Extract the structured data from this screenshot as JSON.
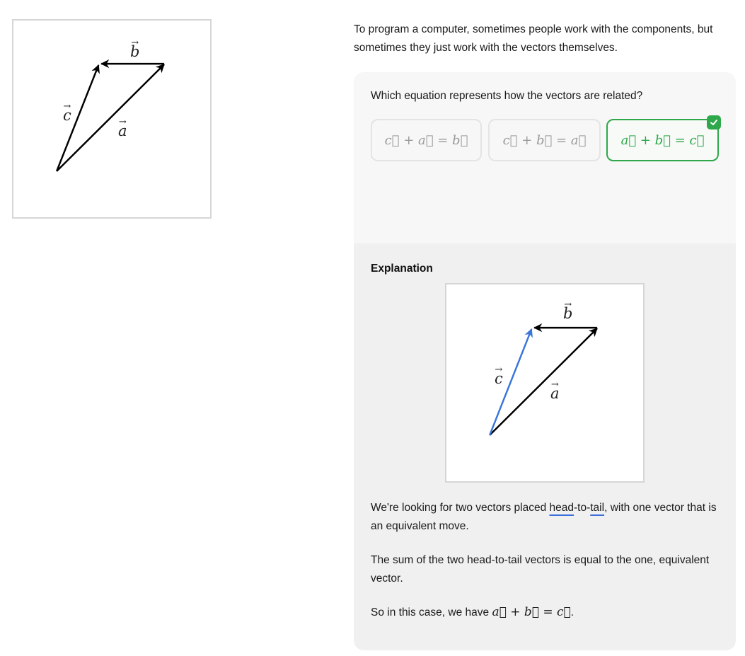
{
  "left_diagram": {
    "labels": {
      "b": "b",
      "c": "c",
      "a": "a",
      "arrow": "→"
    }
  },
  "intro": {
    "text": "To program a computer, sometimes people work with the components, but sometimes they just work with the vectors themselves."
  },
  "question": {
    "prompt": "Which equation represents how the vectors are related?",
    "choices": [
      {
        "label": "c⃗ + a⃗ = b⃗",
        "state": "unselected"
      },
      {
        "label": "c⃗ + b⃗ = a⃗",
        "state": "unselected"
      },
      {
        "label": "a⃗ + b⃗ = c⃗",
        "state": "correct"
      }
    ],
    "correct_icon": "check-icon"
  },
  "explanation": {
    "heading": "Explanation",
    "diagram": {
      "labels": {
        "b": "b",
        "c": "c",
        "a": "a",
        "arrow": "→"
      },
      "highlight_color": "#3a75db"
    },
    "para1_before": "We're looking for two vectors placed ",
    "term_head": "head",
    "term_sep": "-to-",
    "term_tail": "tail",
    "para1_after": ", with one vector that is an equivalent move.",
    "para2": "The sum of the two head-to-tail vectors is equal to the one, equivalent vector.",
    "para3_before": "So in this case, we have ",
    "para3_math": "a⃗ + b⃗ = c⃗",
    "para3_after": "."
  },
  "colors": {
    "correct": "#2ea84a",
    "link_underline": "#3b6fdc",
    "question_bg": "#f7f7f7",
    "explain_bg": "#f0f0f0"
  }
}
